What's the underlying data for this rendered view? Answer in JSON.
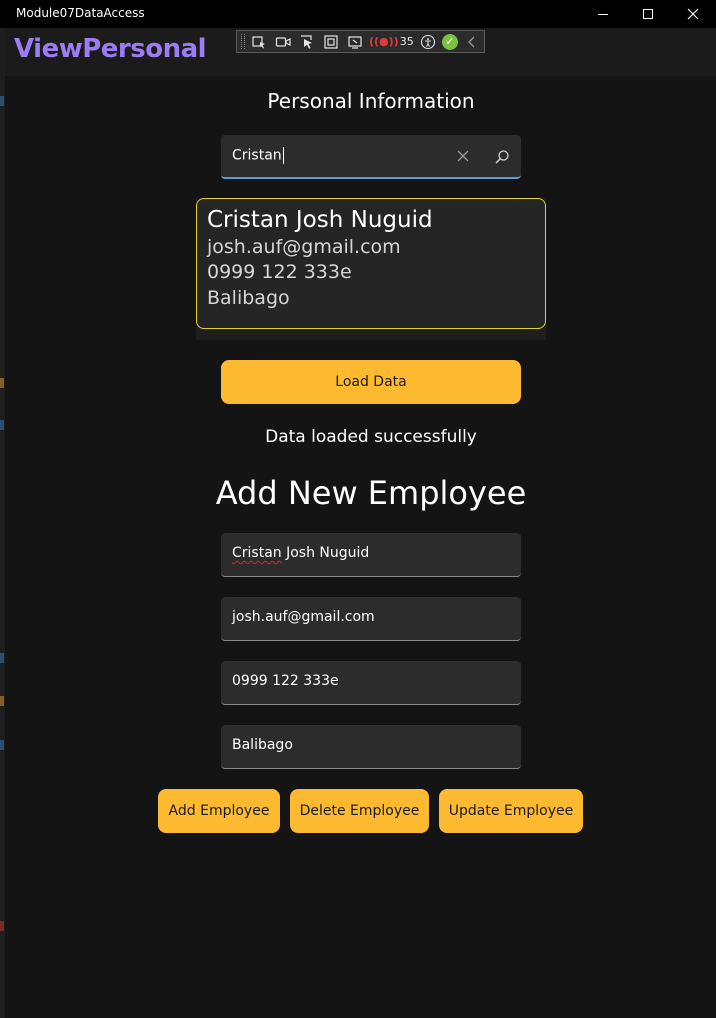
{
  "window": {
    "title": "Module07DataAccess",
    "app_title": "ViewPersonal",
    "app_title_color": "#9b7cf2"
  },
  "debug_toolbar": {
    "icons": [
      "select-element-icon",
      "record-icon",
      "pointer-select-icon",
      "layout-bounds-icon",
      "track-focus-icon",
      "binding-failures-icon",
      "accessibility-icon",
      "status-ok-icon",
      "collapse-chevron-icon"
    ],
    "binding_failures_count": "35"
  },
  "personal": {
    "heading": "Personal Information",
    "search": {
      "value": "Cristan"
    },
    "card": {
      "name": "Cristan Josh Nuguid",
      "email": "josh.auf@gmail.com",
      "phone": "0999 122 333e",
      "address": "Balibago"
    },
    "load_button": "Load Data",
    "status_message": "Data loaded successfully"
  },
  "add_employee": {
    "heading": "Add New Employee",
    "name_field": {
      "first": "Cristan",
      "rest": " Josh Nuguid"
    },
    "email_field": "josh.auf@gmail.com",
    "phone_field": "0999 122 333e",
    "address_field": "Balibago",
    "buttons": {
      "add": "Add Employee",
      "delete": "Delete Employee",
      "update": "Update Employee"
    }
  },
  "colors": {
    "accent_button": "#fdba30",
    "card_border": "#e3d324",
    "search_focus_border": "#5b9bd5",
    "background": "#141414"
  }
}
